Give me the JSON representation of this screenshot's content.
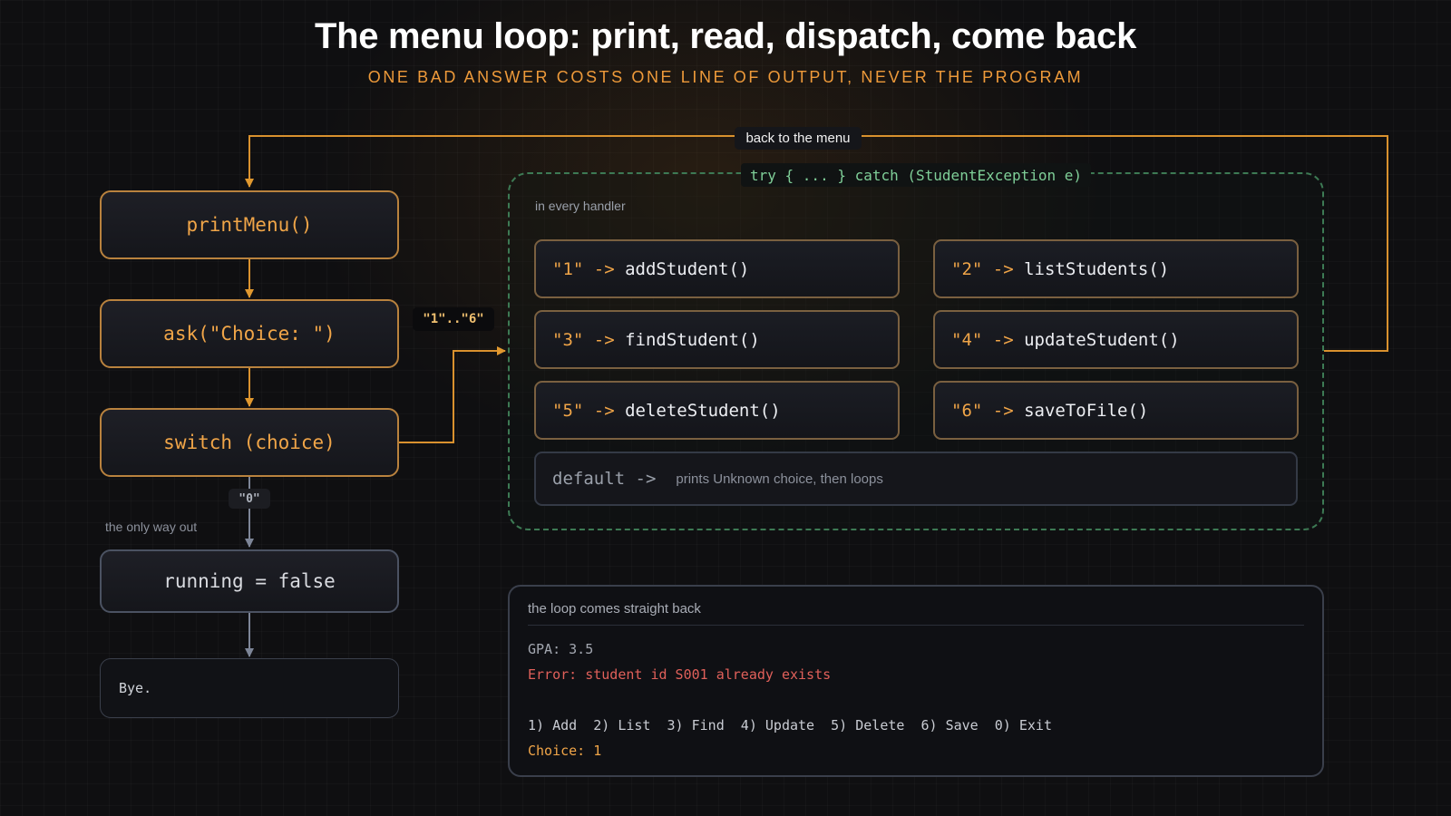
{
  "header": {
    "title": "The menu loop: print, read, dispatch, come back",
    "subtitle": "ONE BAD ANSWER COSTS ONE LINE OF OUTPUT, NEVER THE PROGRAM"
  },
  "flow": {
    "print_menu": "printMenu()",
    "ask": "ask(\"Choice: \")",
    "switch": "switch (choice)",
    "running_false": "running = false",
    "bye": "Bye.",
    "range_label": "\"1\"..\"6\"",
    "exit_label": "\"0\"",
    "exit_note": "the only way out",
    "loop_back_label": "back to the menu"
  },
  "try_block": {
    "label": "try { ... } catch (StudentException e)",
    "note": "in every handler",
    "handlers": [
      {
        "key": "\"1\"",
        "arrow": " -> ",
        "fn": "addStudent()"
      },
      {
        "key": "\"2\"",
        "arrow": " -> ",
        "fn": "listStudents()"
      },
      {
        "key": "\"3\"",
        "arrow": " -> ",
        "fn": "findStudent()"
      },
      {
        "key": "\"4\"",
        "arrow": " -> ",
        "fn": "updateStudent()"
      },
      {
        "key": "\"5\"",
        "arrow": " -> ",
        "fn": "deleteStudent()"
      },
      {
        "key": "\"6\"",
        "arrow": " -> ",
        "fn": "saveToFile()"
      }
    ],
    "default_keyword": "default ->",
    "default_desc": "prints Unknown choice, then loops"
  },
  "console": {
    "title": "the loop comes straight back",
    "lines": [
      "GPA: 3.5",
      "Error: student id S001 already exists",
      "1) Add  2) List  3) Find  4) Update  5) Delete  6) Save  0) Exit",
      "Choice: 1"
    ]
  },
  "colors": {
    "accent_orange": "#f0a548",
    "wire_orange": "#d9912e",
    "try_green": "#7fcf98",
    "error_red": "#e0605a",
    "wire_grey": "#6b7385"
  }
}
